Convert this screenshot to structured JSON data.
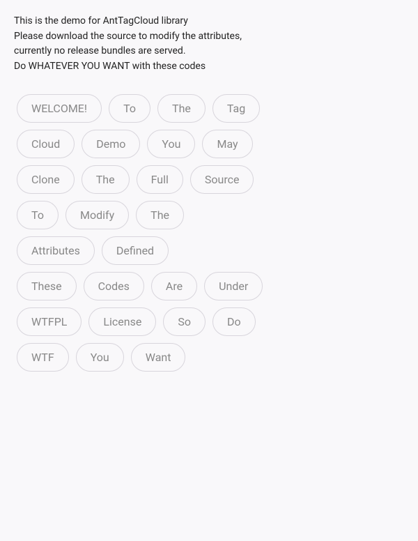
{
  "description": {
    "line1": "This is the demo for AntTagCloud library",
    "line2": "Please download the source to modify the attributes,",
    "line3": "currently no release bundles are served.",
    "line4": "Do WHATEVER YOU WANT with these codes"
  },
  "rows": [
    [
      "WELCOME!",
      "To",
      "The",
      "Tag"
    ],
    [
      "Cloud",
      "Demo",
      "You",
      "May"
    ],
    [
      "Clone",
      "The",
      "Full",
      "Source"
    ],
    [
      "To",
      "Modify",
      "The"
    ],
    [
      "Attributes",
      "Defined"
    ],
    [
      "These",
      "Codes",
      "Are",
      "Under"
    ],
    [
      "WTFPL",
      "License",
      "So",
      "Do"
    ],
    [
      "WTF",
      "You",
      "Want"
    ]
  ]
}
